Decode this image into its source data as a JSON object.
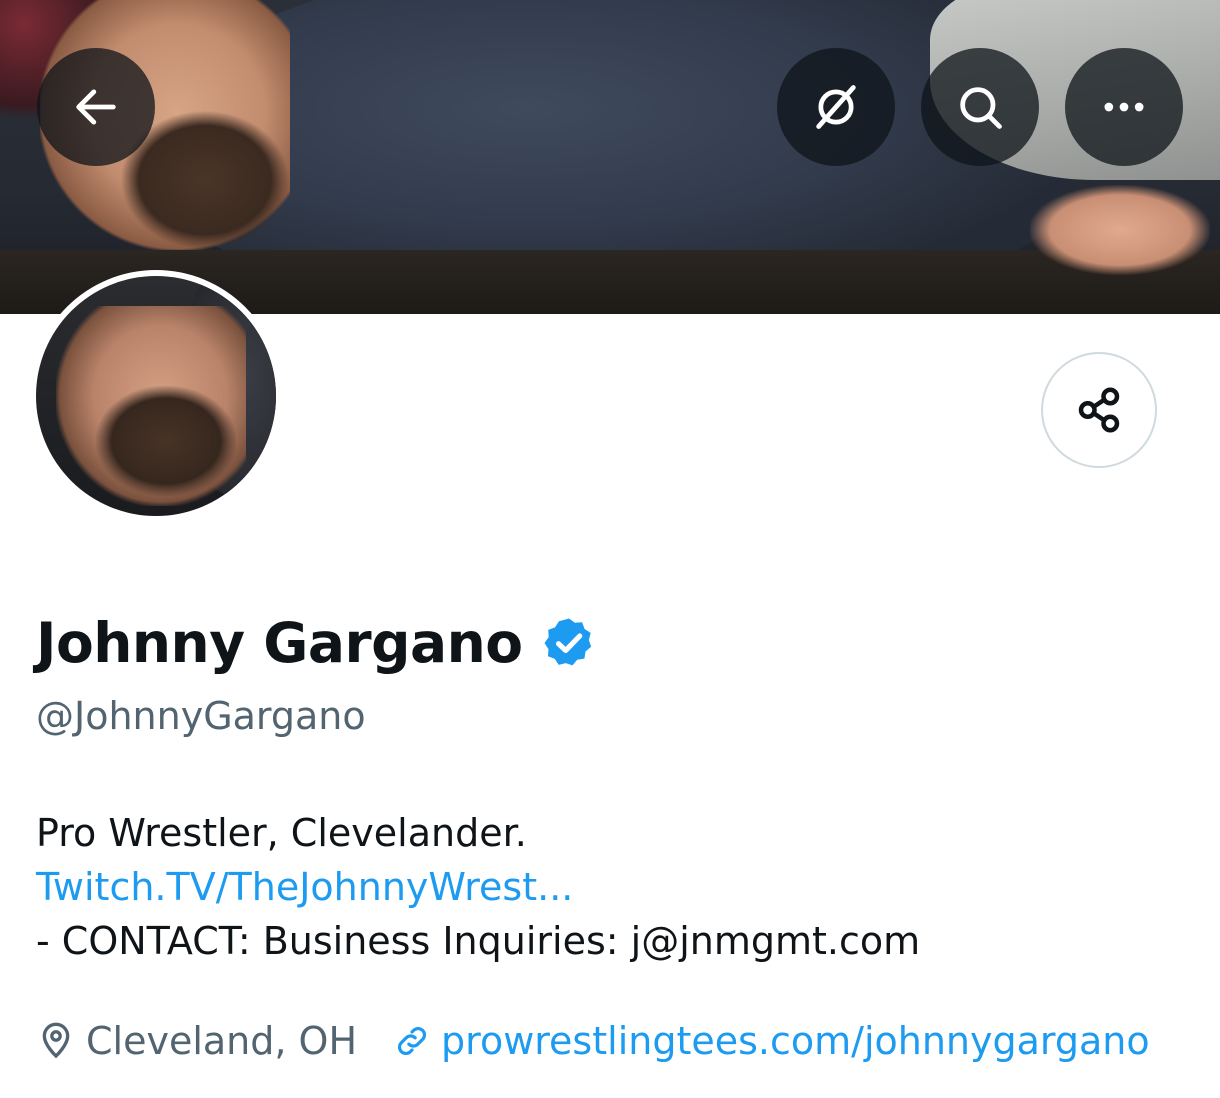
{
  "header": {
    "icons": {
      "back": "arrow-left-icon",
      "grok": "grok-icon",
      "search": "search-icon",
      "more": "more-dots-icon"
    }
  },
  "profile": {
    "name": "Johnny Gargano",
    "verified": true,
    "handle": "@JohnnyGargano",
    "bio_line1": "Pro Wrestler, Clevelander.",
    "bio_link": "Twitch.TV/TheJohnnyWrest...",
    "bio_line3": "- CONTACT: Business Inquiries: j@jnmgmt.com",
    "location": "Cleveland, OH",
    "website": "prowrestlingtees.com/johnnygargano"
  },
  "colors": {
    "accent": "#1d9bf0",
    "secondary_text": "#536471",
    "primary_text": "#0f1419"
  }
}
